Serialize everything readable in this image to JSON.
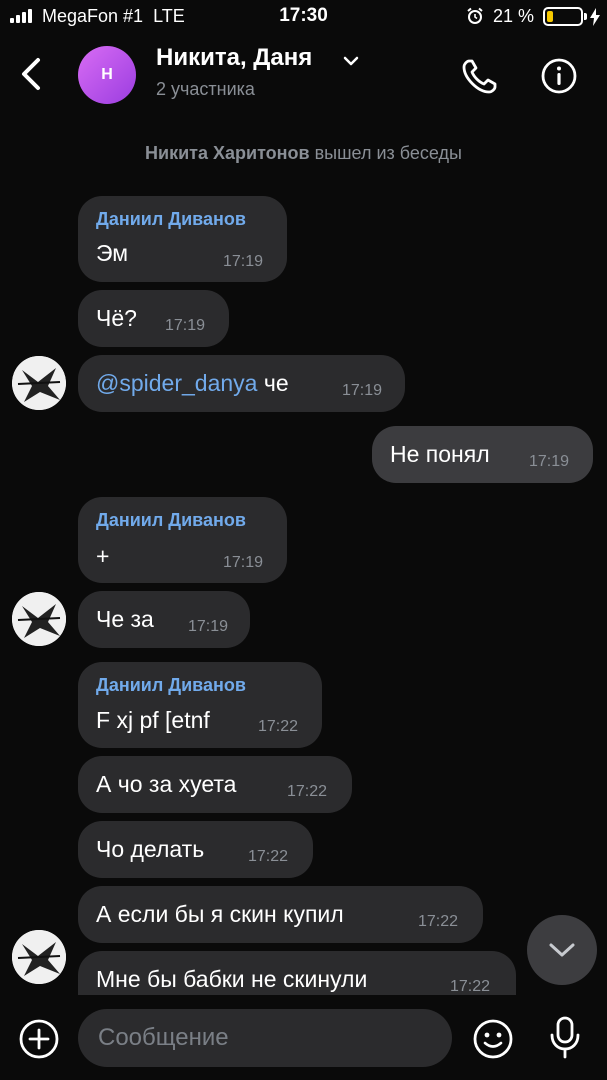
{
  "status_bar": {
    "carrier": "MegaFon #1",
    "network": "LTE",
    "time": "17:30",
    "battery_percent": "21 %"
  },
  "header": {
    "avatar_letter": "Н",
    "title": "Никита, Даня",
    "subtitle": "2 участника"
  },
  "service_message": {
    "name": "Никита Харитонов",
    "action": "вышел из беседы"
  },
  "messages": [
    {
      "sender": "Даниил Диванов",
      "text": "Эм",
      "time": "17:19"
    },
    {
      "text": "Чё?",
      "time": "17:19"
    },
    {
      "mention": "@spider_danya",
      "text": " че",
      "time": "17:19"
    },
    {
      "text": "Не понял",
      "time": "17:19",
      "outgoing": true
    },
    {
      "sender": "Даниил Диванов",
      "text": "+",
      "time": "17:19"
    },
    {
      "text": "Че за",
      "time": "17:19"
    },
    {
      "sender": "Даниил Диванов",
      "text": "F xj pf [etnf",
      "time": "17:22"
    },
    {
      "text": "А чо за хуета",
      "time": "17:22"
    },
    {
      "text": "Чо делать",
      "time": "17:22"
    },
    {
      "text": "А если бы я скин купил",
      "time": "17:22"
    },
    {
      "text": "Мне бы бабки не скинули",
      "time": "17:22"
    }
  ],
  "composer": {
    "placeholder": "Сообщение"
  },
  "colors": {
    "background": "#0a0a0a",
    "bubble_in": "#2b2b2d",
    "bubble_out": "#3c3c3f",
    "accent": "#71aaeb",
    "avatar_gradient": "#b454ea"
  },
  "icons": [
    "back-chevron-icon",
    "chevron-down-icon",
    "phone-icon",
    "info-icon",
    "arrow-down-icon",
    "plus-circle-icon",
    "smile-icon",
    "microphone-icon",
    "alarm-icon",
    "charging-icon"
  ]
}
